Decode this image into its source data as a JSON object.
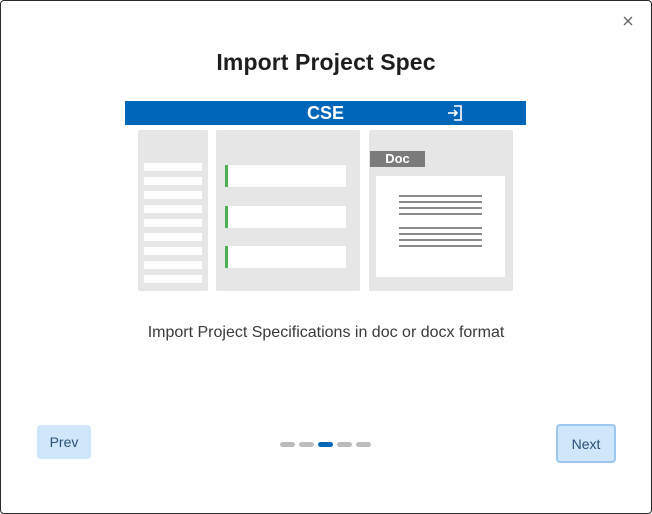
{
  "dialog": {
    "title": "Import Project Spec",
    "close_icon": "close-icon",
    "illustration": {
      "brand": "CSE",
      "doc_tag": "Doc",
      "import_icon": "import-icon"
    },
    "description": "Import Project Specifications in doc or docx format",
    "prev_label": "Prev",
    "next_label": "Next",
    "pagination": {
      "total": 5,
      "current": 3
    }
  },
  "colors": {
    "brand_blue": "#0067b8",
    "button_bg": "#cfe6fb",
    "accent_green": "#4caf50",
    "dot_inactive": "#bdbdbd"
  }
}
